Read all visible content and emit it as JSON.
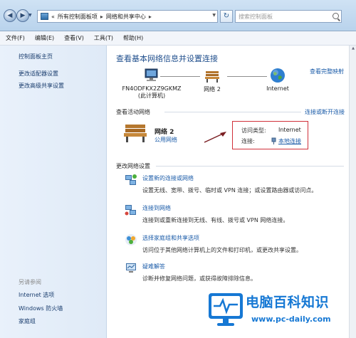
{
  "address_bar": {
    "back_glyph": "◀",
    "forward_glyph": "▶",
    "chevron": "«",
    "path": [
      "所有控制面板项",
      "网络和共享中心"
    ],
    "separator": "▸",
    "dropdown_glyph": "▼",
    "refresh_glyph": "↻",
    "search_placeholder": "搜索控制面板"
  },
  "menu": [
    "文件(F)",
    "编辑(E)",
    "查看(V)",
    "工具(T)",
    "帮助(H)"
  ],
  "left_pane": {
    "links": [
      "控制面板主页",
      "更改适配器设置",
      "更改高级共享设置"
    ],
    "see_also_heading": "另请参阅",
    "see_also_links": [
      "Internet 选项",
      "Windows 防火墙",
      "家庭组"
    ]
  },
  "main": {
    "title": "查看基本网络信息并设置连接",
    "see_full_map": "查看完整映射",
    "network_map": {
      "computer_name": "FN4ODFKX2Z9GKMZ",
      "computer_sub": "(此计算机)",
      "network": "网络  2",
      "internet": "Internet"
    },
    "active_networks": {
      "heading": "查看活动网络",
      "action": "连接或断开连接",
      "name": "网络  2",
      "type": "公用网络",
      "access_type_label": "访问类型:",
      "access_type_value": "Internet",
      "connection_label": "连接:",
      "connection_value": "本地连接"
    },
    "change_settings": {
      "heading": "更改网络设置",
      "tasks": [
        {
          "icon": "new-connection-icon",
          "title": "设置新的连接或网络",
          "desc": "设置无线、宽带、拨号、临时或 VPN 连接；或设置路由器或访问点。"
        },
        {
          "icon": "connect-network-icon",
          "title": "连接到网络",
          "desc": "连接到或重新连接到无线、有线、拨号或 VPN 网络连接。"
        },
        {
          "icon": "homegroup-icon",
          "title": "选择家庭组和共享选项",
          "desc": "访问位于其他网络计算机上的文件和打印机，或更改共享设置。"
        },
        {
          "icon": "troubleshoot-icon",
          "title": "疑难解答",
          "desc": "诊断并修复网络问题，或获得故障排除信息。"
        }
      ]
    }
  },
  "watermark": {
    "title": "电脑百科知识",
    "url": "www.pc-daily.com"
  },
  "colors": {
    "link": "#1a5ba8",
    "title": "#1f4e8c",
    "highlight_box": "#d0303a",
    "watermark": "#1678d4"
  }
}
